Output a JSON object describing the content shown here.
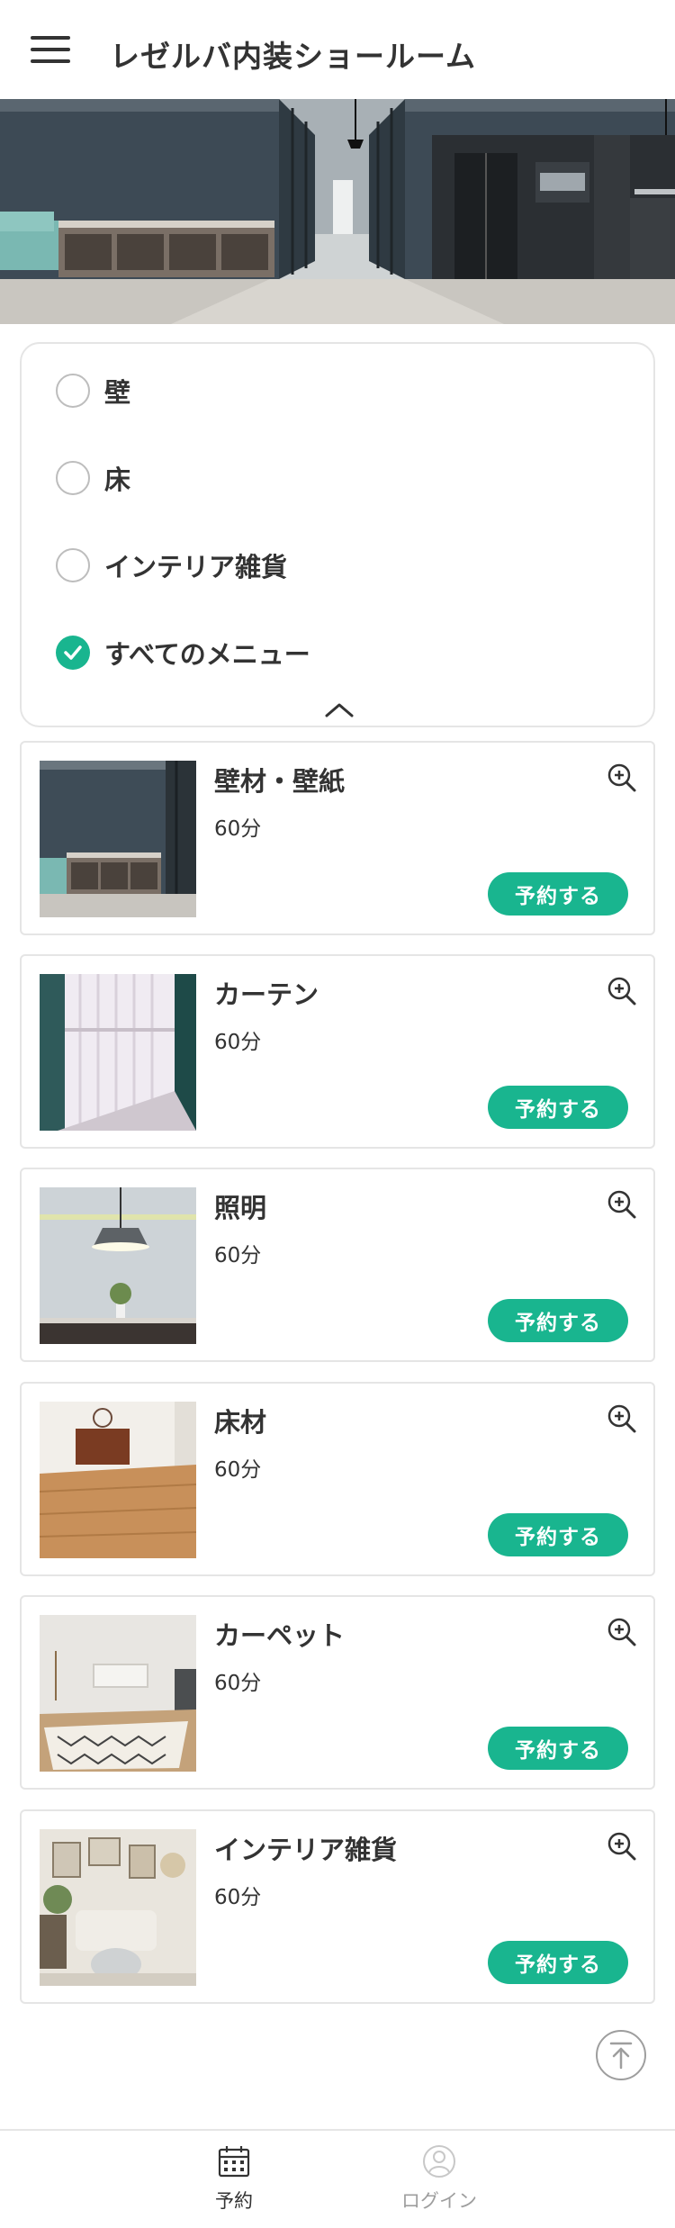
{
  "header": {
    "title": "レゼルバ内装ショールーム"
  },
  "filters": {
    "items": [
      {
        "label": "壁",
        "checked": false
      },
      {
        "label": "床",
        "checked": false
      },
      {
        "label": "インテリア雑貨",
        "checked": false
      },
      {
        "label": "すべてのメニュー",
        "checked": true
      }
    ]
  },
  "menu": {
    "reserve_label": "予約する",
    "items": [
      {
        "title": "壁材・壁紙",
        "duration": "60分"
      },
      {
        "title": "カーテン",
        "duration": "60分"
      },
      {
        "title": "照明",
        "duration": "60分"
      },
      {
        "title": "床材",
        "duration": "60分"
      },
      {
        "title": "カーペット",
        "duration": "60分"
      },
      {
        "title": "インテリア雑貨",
        "duration": "60分"
      }
    ]
  },
  "bottom_nav": {
    "reserve": "予約",
    "login": "ログイン"
  },
  "colors": {
    "accent": "#19b58f",
    "text": "#333333",
    "border": "#e5e5e5",
    "muted": "#9e9e9e"
  },
  "icons": [
    "hamburger-icon",
    "check-icon",
    "chevron-up-icon",
    "zoom-in-icon",
    "arrow-up-icon",
    "calendar-icon",
    "user-icon"
  ]
}
